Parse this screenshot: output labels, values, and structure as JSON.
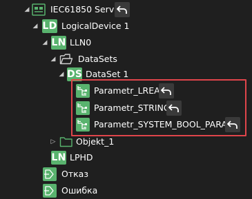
{
  "tree": {
    "server": {
      "label": "IEC61850 Server",
      "icon": "server-icon"
    },
    "logical_device": {
      "badge": "LD",
      "label": "LogicalDevice 1"
    },
    "ln0": {
      "badge": "LN",
      "label": "LLN0"
    },
    "datasets": {
      "label": "DataSets",
      "icon": "folder-open-icon"
    },
    "dataset1": {
      "badge": "DS",
      "label": "DataSet 1"
    },
    "params": [
      {
        "label": "Parametr_LREAL",
        "icon": "data-attribute-icon"
      },
      {
        "label": "Parametr_STRING",
        "icon": "data-attribute-icon"
      },
      {
        "label": "Parametr_SYSTEM_BOOL_PARAM",
        "icon": "data-attribute-icon"
      }
    ],
    "objekt": {
      "label": "Objekt_1",
      "icon": "folder-icon"
    },
    "lphd": {
      "badge": "LN",
      "label": "LPHD"
    },
    "otkaz": {
      "label": "Отказ",
      "icon": "signal-icon"
    },
    "oshibka": {
      "label": "Ошибка",
      "icon": "signal-icon"
    }
  },
  "colors": {
    "background": "#1f1f1f",
    "badge_green": "#59b36e",
    "highlight_red": "#e0454b",
    "undo_button_bg": "#3a3a3a"
  }
}
